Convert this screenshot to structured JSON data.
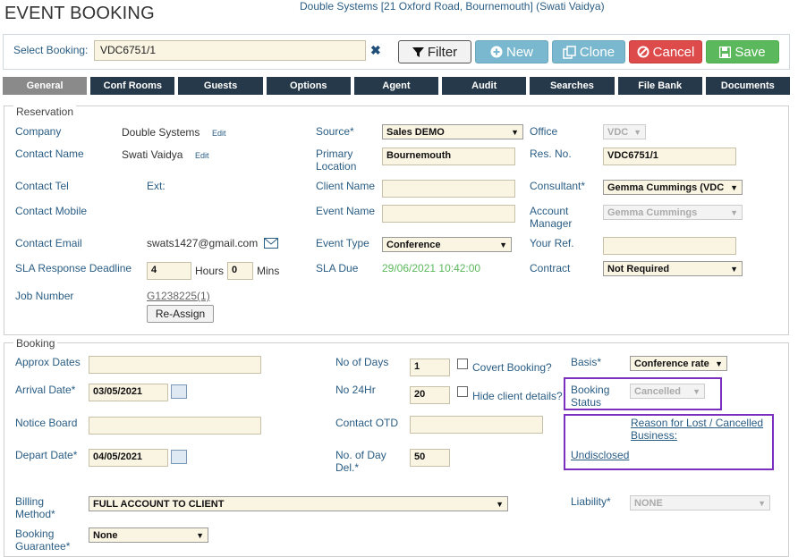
{
  "header": {
    "title": "EVENT BOOKING",
    "subtitle": "Double Systems [21 Oxford Road, Bournemouth] (Swati Vaidya)"
  },
  "select_bar": {
    "label": "Select Booking:",
    "value": "VDC6751/1",
    "clear": "✖",
    "buttons": {
      "filter": "Filter",
      "new": "New",
      "clone": "Clone",
      "cancel": "Cancel",
      "save": "Save"
    }
  },
  "tabs": [
    "General",
    "Conf Rooms",
    "Guests",
    "Options",
    "Agent",
    "Audit",
    "Searches",
    "File Bank",
    "Documents"
  ],
  "reservation": {
    "legend": "Reservation",
    "company_label": "Company",
    "company_value": "Double Systems",
    "edit": "Edit",
    "contact_name_label": "Contact Name",
    "contact_name_value": "Swati Vaidya",
    "contact_tel_label": "Contact Tel",
    "ext_label": "Ext:",
    "contact_mobile_label": "Contact Mobile",
    "contact_email_label": "Contact Email",
    "contact_email_value": "swats1427@gmail.com",
    "sla_label": "SLA Response Deadline",
    "sla_hours": "4",
    "hours_label": "Hours",
    "sla_mins": "0",
    "mins_label": "Mins",
    "job_number_label": "Job Number",
    "job_number_value": "G1238225(1)",
    "reassign": "Re-Assign",
    "source_label": "Source*",
    "source_value": "Sales DEMO",
    "primary_location_label": "Primary Location",
    "primary_location_value": "Bournemouth",
    "client_name_label": "Client Name",
    "event_name_label": "Event Name",
    "event_type_label": "Event Type",
    "event_type_value": "Conference",
    "sla_due_label": "SLA Due",
    "sla_due_value": "29/06/2021 10:42:00",
    "office_label": "Office",
    "office_value": "VDC",
    "res_no_label": "Res. No.",
    "res_no_value": "VDC6751/1",
    "consultant_label": "Consultant*",
    "consultant_value": "Gemma Cummings (VDC",
    "account_manager_label": "Account Manager",
    "account_manager_value": "Gemma Cummings",
    "your_ref_label": "Your Ref.",
    "contract_label": "Contract",
    "contract_value": "Not Required"
  },
  "booking": {
    "legend": "Booking",
    "approx_dates_label": "Approx Dates",
    "arrival_date_label": "Arrival Date*",
    "arrival_date_value": "03/05/2021",
    "notice_board_label": "Notice Board",
    "depart_date_label": "Depart Date*",
    "depart_date_value": "04/05/2021",
    "billing_method_label": "Billing Method*",
    "billing_method_value": "FULL ACCOUNT TO CLIENT",
    "booking_guarantee_label": "Booking Guarantee*",
    "booking_guarantee_value": "None",
    "no_of_days_label": "No of Days",
    "no_of_days_value": "1",
    "covert_label": "Covert Booking?",
    "no_24hr_label": "No 24Hr",
    "no_24hr_value": "20",
    "hide_client_label": "Hide client details?",
    "contact_otd_label": "Contact OTD",
    "no_day_del_label": "No. of Day Del.*",
    "no_day_del_value": "50",
    "basis_label": "Basis*",
    "basis_value": "Conference rate",
    "booking_status_label": "Booking Status",
    "booking_status_value": "Cancelled",
    "reason_label": "Reason for Lost / Cancelled Business:",
    "reason_value": "Undisclosed",
    "liability_label": "Liability*",
    "liability_value": "NONE"
  }
}
